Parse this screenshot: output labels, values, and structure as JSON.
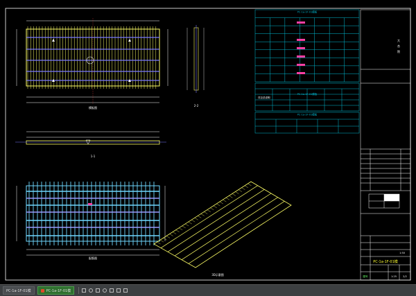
{
  "drawing": {
    "colors": {
      "background": "#000000",
      "frame": "#ffffff",
      "table": "#00bcd4",
      "rebar": "#ffff66",
      "rebar_row": "#7a7aff",
      "highlight": "#ff3fa4",
      "title_text": "#ffff33",
      "green": "#6cff6c"
    },
    "title_block": {
      "drawing_number": "PC-1a-1F-01模",
      "scale_value": "1:25",
      "page_value": "1:50",
      "code": "图号",
      "sheet": "2/2"
    },
    "top_table": {
      "title": "PC-1a-1F-01模板"
    },
    "mid_table": {
      "title": "PC-1a-1F-01模板"
    },
    "lower_table": {
      "title": "PC-1a-1F-01模板"
    },
    "view_labels": {
      "plan_top": "模板图",
      "section": "1-1",
      "side": "2-2",
      "rebar": "配筋图",
      "iso": "3D示意图"
    },
    "note_text": "详见总说明"
  },
  "taskbar": {
    "items": [
      {
        "label": "PC-1a-1F-01模",
        "active": false
      },
      {
        "label": "PC-1a-1F-01模",
        "active": true
      }
    ]
  }
}
